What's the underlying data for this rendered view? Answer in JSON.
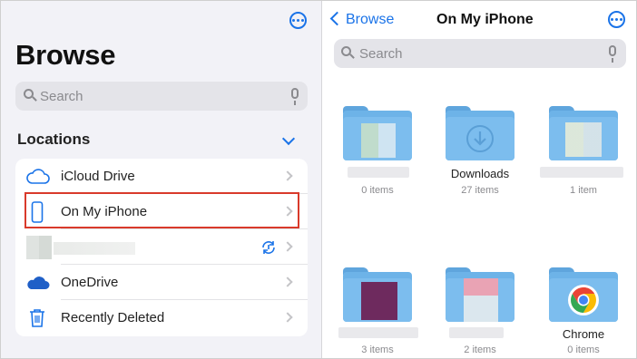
{
  "sidebar": {
    "title": "Browse",
    "search_placeholder": "Search",
    "section_title": "Locations",
    "items": [
      {
        "label": "iCloud Drive",
        "icon": "cloud-icon"
      },
      {
        "label": "On My iPhone",
        "icon": "iphone-icon"
      },
      {
        "label": "",
        "icon": "sync-icon"
      },
      {
        "label": "OneDrive",
        "icon": "onedrive-cloud-icon"
      },
      {
        "label": "Recently Deleted",
        "icon": "trash-icon"
      }
    ]
  },
  "right_pane": {
    "back_label": "Browse",
    "title": "On My iPhone",
    "search_placeholder": "Search",
    "folders": [
      {
        "name": "",
        "count": "0 items"
      },
      {
        "name": "Downloads",
        "count": "27 items"
      },
      {
        "name": "",
        "count": "1 item"
      },
      {
        "name": "",
        "count": "3 items"
      },
      {
        "name": "",
        "count": "2 items"
      },
      {
        "name": "Chrome",
        "count": "0 items"
      }
    ]
  },
  "colors": {
    "accent": "#1a73e8",
    "highlight": "#d93a2b",
    "folder": "#7cbdee"
  }
}
